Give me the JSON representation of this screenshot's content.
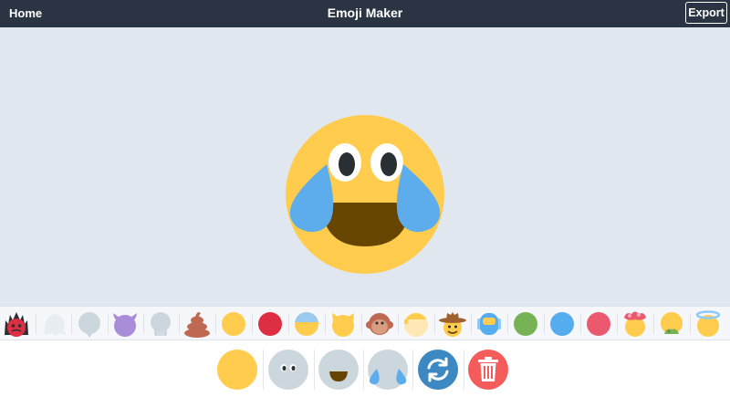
{
  "header": {
    "home_label": "Home",
    "title": "Emoji Maker",
    "export_label": "Export"
  },
  "preview": {
    "face_color": "#ffcc4d",
    "eye_white": "#ffffff",
    "pupil_color": "#292f33",
    "mouth_color": "#664500",
    "tear_color": "#5dadec"
  },
  "palette": {
    "items": [
      {
        "name": "fire-head-face-icon",
        "color": "#dd2e44"
      },
      {
        "name": "ghost-face-icon",
        "color": "#e8edf1"
      },
      {
        "name": "speech-bubble-face-icon",
        "color": "#ccd6dd"
      },
      {
        "name": "devil-face-icon",
        "color": "#aa8dd8"
      },
      {
        "name": "skull-face-icon",
        "color": "#ccd6dd"
      },
      {
        "name": "poop-face-icon",
        "color": "#bf6952"
      },
      {
        "name": "yellow-face-icon",
        "color": "#ffcc4d"
      },
      {
        "name": "red-face-icon",
        "color": "#dd2e44"
      },
      {
        "name": "cold-sweat-face-icon",
        "color": "#ffcc4d"
      },
      {
        "name": "cat-face-icon",
        "color": "#ffcc4d"
      },
      {
        "name": "monkey-face-icon",
        "color": "#d99e82"
      },
      {
        "name": "bandaged-face-icon",
        "color": "#ffe8b6"
      },
      {
        "name": "cowboy-face-icon",
        "color": "#ffcc4d"
      },
      {
        "name": "astronaut-face-icon",
        "color": "#55acee"
      },
      {
        "name": "green-face-icon",
        "color": "#77b255"
      },
      {
        "name": "blue-face-icon",
        "color": "#55acee"
      },
      {
        "name": "pink-face-icon",
        "color": "#ea596e"
      },
      {
        "name": "exploding-head-face-icon",
        "color": "#ffcc4d"
      },
      {
        "name": "nauseated-face-icon",
        "color": "#ffcc4d"
      },
      {
        "name": "halo-face-icon",
        "color": "#ffcc4d"
      }
    ]
  },
  "layers": {
    "face_color": "#ffcc4d",
    "placeholder_color": "#ccd6dd",
    "refresh_color": "#3b88c3",
    "delete_color": "#f45b5b"
  }
}
